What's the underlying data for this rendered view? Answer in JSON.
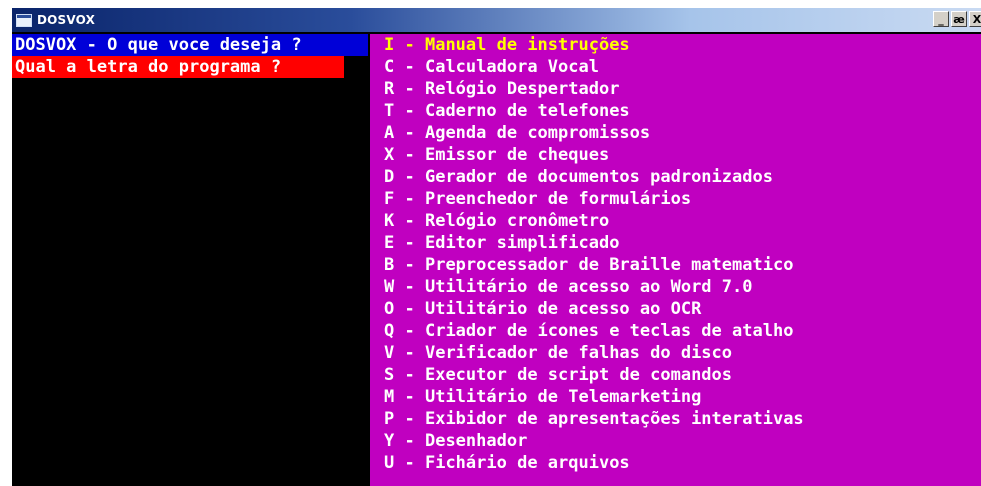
{
  "window": {
    "title": "DOSVOX",
    "controls": [
      "_",
      "æ",
      "X"
    ]
  },
  "prompts": {
    "question": "DOSVOX - O que voce deseja ?",
    "letter_prompt": "Qual a letra do programa ?"
  },
  "menu": {
    "items": [
      {
        "key": "I",
        "label": "Manual de instruções",
        "selected": true
      },
      {
        "key": "C",
        "label": "Calculadora Vocal"
      },
      {
        "key": "R",
        "label": "Relógio Despertador"
      },
      {
        "key": "T",
        "label": "Caderno de telefones"
      },
      {
        "key": "A",
        "label": "Agenda de compromissos"
      },
      {
        "key": "X",
        "label": "Emissor de cheques"
      },
      {
        "key": "D",
        "label": "Gerador de documentos padronizados"
      },
      {
        "key": "F",
        "label": "Preenchedor de formulários"
      },
      {
        "key": "K",
        "label": "Relógio cronômetro"
      },
      {
        "key": "E",
        "label": "Editor simplificado"
      },
      {
        "key": "B",
        "label": "Preprocessador de Braille matematico"
      },
      {
        "key": "W",
        "label": "Utilitário de acesso ao Word 7.0"
      },
      {
        "key": "O",
        "label": "Utilitário de acesso ao OCR"
      },
      {
        "key": "Q",
        "label": "Criador de ícones e teclas de atalho"
      },
      {
        "key": "V",
        "label": "Verificador de falhas do disco"
      },
      {
        "key": "S",
        "label": "Executor de script de comandos"
      },
      {
        "key": "M",
        "label": "Utilitário de Telemarketing"
      },
      {
        "key": "P",
        "label": "Exibidor de apresentações interativas"
      },
      {
        "key": "Y",
        "label": "Desenhador"
      },
      {
        "key": "U",
        "label": "Fichário de arquivos"
      }
    ]
  },
  "colors": {
    "console_bg": "#000000",
    "prompt_question_bg": "#0000d8",
    "prompt_letter_bg": "#ff0000",
    "menu_bg": "#c000c0",
    "menu_text": "#ffffff",
    "menu_selected_text": "#ffff00"
  }
}
